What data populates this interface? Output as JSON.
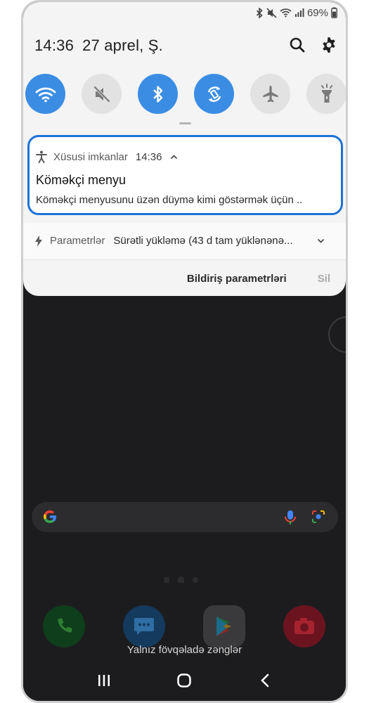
{
  "status_bar": {
    "battery": "69%"
  },
  "header": {
    "time": "14:36",
    "date": "27 aprel, Ş."
  },
  "quick_settings": [
    {
      "name": "wifi",
      "state": "on"
    },
    {
      "name": "sound-mute",
      "state": "off"
    },
    {
      "name": "bluetooth",
      "state": "on"
    },
    {
      "name": "auto-rotate",
      "state": "on"
    },
    {
      "name": "airplane",
      "state": "off"
    },
    {
      "name": "flashlight",
      "state": "off"
    }
  ],
  "notification": {
    "app": "Xüsusi imkanlar",
    "time": "14:36",
    "title": "Köməkçi menyu",
    "text": "Köməkçi menyusunu üzən düymə kimi göstərmək üçün .."
  },
  "notification2": {
    "label": "Parametrlər",
    "text": "Sürətli yükləmə (43 d tam yüklənənə..."
  },
  "actions": {
    "settings": "Bildiriş parametrləri",
    "clear": "Sil"
  },
  "home": {
    "dnd_text": "Yalnız fövqəladə zənglər"
  },
  "colors": {
    "accent": "#3b8de4",
    "highlight": "#1d72d8",
    "shade_bg": "#f4f4f4"
  }
}
